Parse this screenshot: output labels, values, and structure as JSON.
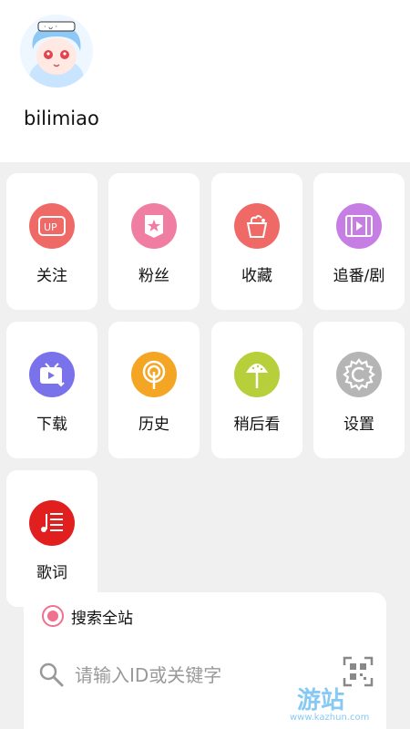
{
  "profile": {
    "username": "bilimiao"
  },
  "menu": [
    {
      "label": "关注",
      "icon": "up-icon",
      "color": "#ef6a67"
    },
    {
      "label": "粉丝",
      "icon": "fans-badge-icon",
      "color": "#f07ea2"
    },
    {
      "label": "收藏",
      "icon": "favorite-cup-icon",
      "color": "#ef6a67"
    },
    {
      "label": "追番/剧",
      "icon": "film-icon",
      "color": "#c77ee4"
    },
    {
      "label": "下载",
      "icon": "tv-download-icon",
      "color": "#7a72ea"
    },
    {
      "label": "历史",
      "icon": "history-icon",
      "color": "#f5a524"
    },
    {
      "label": "稍后看",
      "icon": "watermelon-icon",
      "color": "#b7cf3b"
    },
    {
      "label": "设置",
      "icon": "gear-icon",
      "color": "#b5b5b5"
    },
    {
      "label": "歌词",
      "icon": "lyrics-icon",
      "color": "#e21f1f"
    }
  ],
  "search": {
    "scope_label": "搜索全站",
    "placeholder": "请输入ID或关键字"
  },
  "watermark": {
    "main": "游站",
    "sub": "www.kazhun.com"
  }
}
